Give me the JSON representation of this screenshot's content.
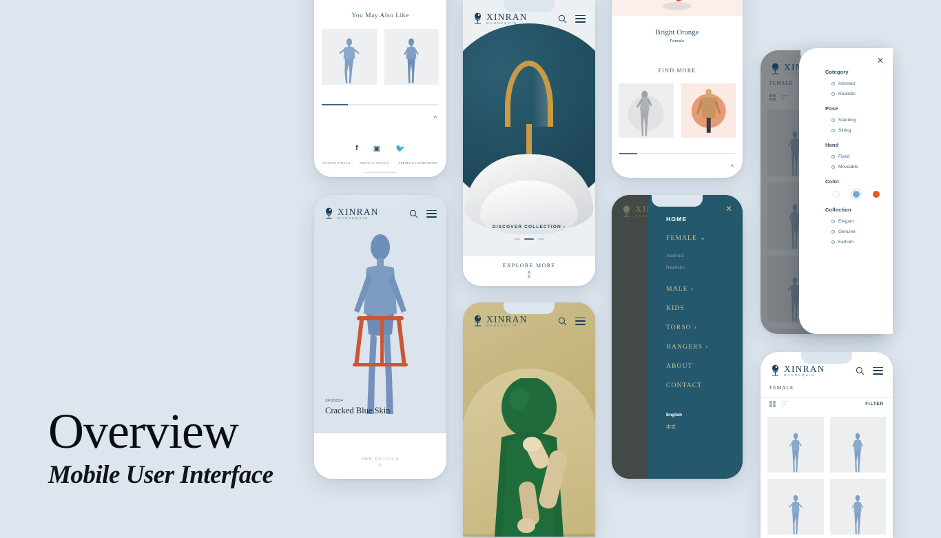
{
  "poster": {
    "title": "Overview",
    "subtitle": "Mobile User Interface",
    "background_color": "#dde5ee"
  },
  "brand": {
    "name": "XINRAN",
    "tagline": "MANNEQUIN",
    "accent_teal": "#24586c",
    "accent_gold": "#c9b98f",
    "accent_blue": "#2f5570"
  },
  "screens": {
    "recommendations_footer": {
      "section_title": "You May Also Like",
      "cards": [
        "mannequin-blue-standing",
        "mannequin-blue-walking"
      ],
      "scroll_top_icon": "chevron-up-icon",
      "social": [
        {
          "name": "facebook-icon",
          "glyph": "f"
        },
        {
          "name": "instagram-icon",
          "glyph": "▣"
        },
        {
          "name": "twitter-icon",
          "glyph": "✈"
        }
      ],
      "legal_links": [
        "COOKIE POLICY",
        "PRIVACY POLICY",
        "TERMS & CONDITIONS"
      ],
      "copyright": "Copyright@ Xinran Display"
    },
    "hanger_hero": {
      "cta": "DISCOVER COLLECTION ›",
      "carousel": {
        "total": 3,
        "active_index": 2
      },
      "explore": "EXPLORE MORE",
      "explore_icon": "double-chevron-down-icon",
      "hero_subject": "gold-hook-marble-hanger"
    },
    "product_bright_orange": {
      "product_name": "Bright Orange",
      "gender": "Female",
      "find_more": "FIND MORE",
      "cards": [
        "mannequin-grey-realistic",
        "torso-wood-orange"
      ],
      "scroll_top_icon": "chevron-up-icon"
    },
    "product_detail_blue": {
      "sku": "XF00034",
      "product_name": "Cracked Blue Skin",
      "see_details": "SEE DETAILS",
      "see_details_icon": "double-chevron-down-icon"
    },
    "hero_green": {
      "subject": "green-wood-mannequin"
    },
    "nav_drawer": {
      "close_icon": "close-icon",
      "items": [
        {
          "label": "HOME",
          "state": "active",
          "chevron": ""
        },
        {
          "label": "FEMALE",
          "state": "expanded",
          "chevron": "⌄"
        },
        {
          "label": "MALE",
          "state": "default",
          "chevron": "›"
        },
        {
          "label": "KIDS",
          "state": "default",
          "chevron": ""
        },
        {
          "label": "TORSO",
          "state": "default",
          "chevron": "›"
        },
        {
          "label": "HANGERS",
          "state": "default",
          "chevron": "›"
        },
        {
          "label": "ABOUT",
          "state": "default",
          "chevron": ""
        },
        {
          "label": "CONTACT",
          "state": "default",
          "chevron": ""
        }
      ],
      "subitems": [
        "Abstract",
        "Realistic"
      ],
      "languages": [
        {
          "label": "English",
          "selected": true
        },
        {
          "label": "中文",
          "selected": false
        }
      ]
    },
    "filter_sheet": {
      "close_icon": "close-icon",
      "groups": [
        {
          "title": "Category",
          "options": [
            "Abstract",
            "Realistic"
          ]
        },
        {
          "title": "Pose",
          "options": [
            "Standing",
            "Sitting"
          ]
        },
        {
          "title": "Hand",
          "options": [
            "Fixed",
            "Moveable"
          ]
        },
        {
          "title": "Collection",
          "options": [
            "Elegant",
            "Genuine",
            "Fathom"
          ]
        }
      ],
      "color_group_title": "Color",
      "color_swatches": [
        "#ffffff",
        "#7aa4ca",
        "#e5562a"
      ],
      "color_selected_index": 1
    },
    "catalog_grid": {
      "breadcrumb": "FEMALE",
      "view_icon": "grid-view-icon",
      "sort_icon": "sort-icon",
      "filter_label": "FILTER",
      "items": [
        "mannequin-1",
        "mannequin-2",
        "mannequin-3",
        "mannequin-4"
      ]
    },
    "catalog_grid_dimmed": {
      "breadcrumb": "FEMALE",
      "view_icon": "grid-view-icon",
      "sort_icon": "sort-icon",
      "items": [
        "mannequin-1",
        "mannequin-2",
        "mannequin-3",
        "mannequin-4"
      ]
    }
  }
}
